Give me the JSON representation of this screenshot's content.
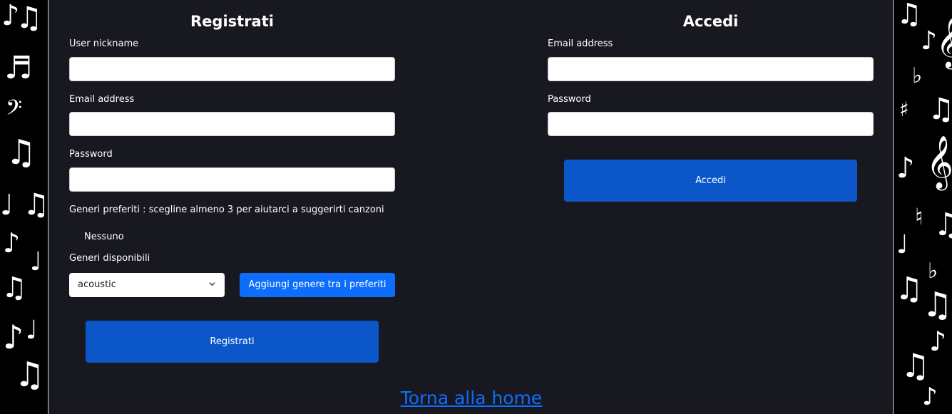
{
  "register": {
    "title": "Registrati",
    "nickname_label": "User nickname",
    "nickname_value": "",
    "email_label": "Email address",
    "email_value": "",
    "password_label": "Password",
    "password_value": "",
    "favorite_genres_text": "Generi preferiti : scegline almeno 3 per aiutarci a suggerirti canzoni",
    "favorite_genres_empty": "Nessuno",
    "available_genres_label": "Generi disponibili",
    "genre_select_value": "acoustic",
    "add_genre_button": "Aggiungi genere tra i preferiti",
    "submit_button": "Registrati"
  },
  "login": {
    "title": "Accedi",
    "email_label": "Email address",
    "email_value": "",
    "password_label": "Password",
    "password_value": "",
    "submit_button": "Accedi"
  },
  "footer": {
    "home_link": "Torna alla home"
  },
  "colors": {
    "page_background": "#181820",
    "primary_button": "#0d6efd",
    "submit_button": "#0b57c9",
    "link": "#0d6efd"
  },
  "icons": {
    "select_chevron": "chevron-down-icon",
    "background_decoration": "music-notes-icon"
  }
}
